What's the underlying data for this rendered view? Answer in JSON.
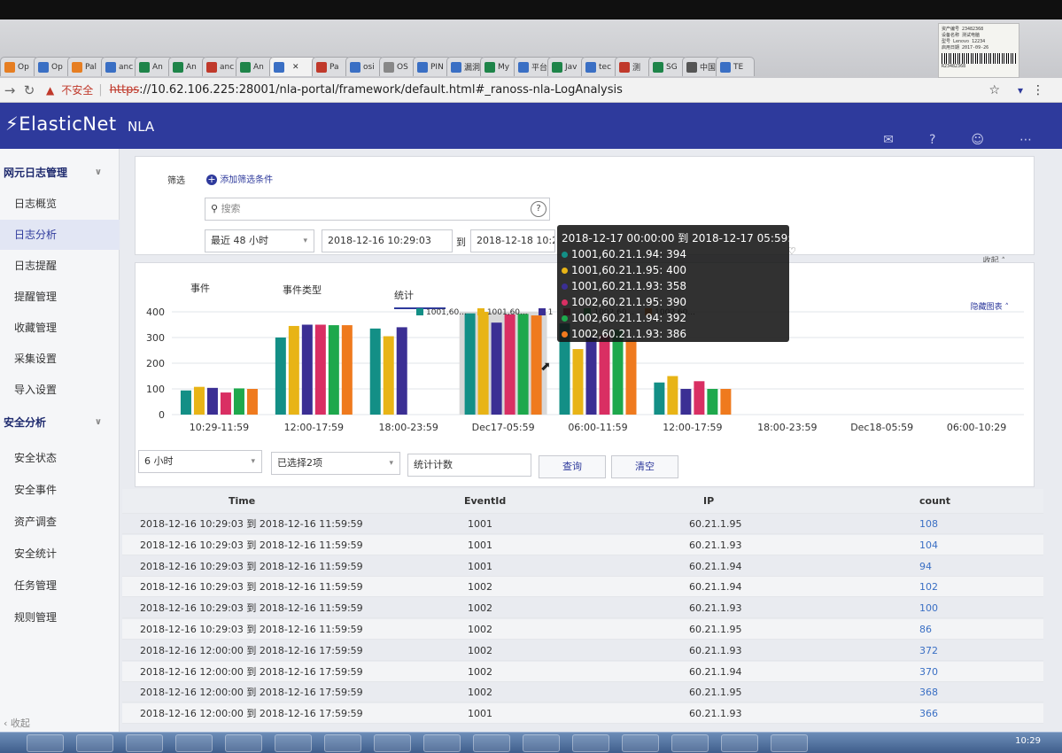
{
  "browser": {
    "tabs": [
      "Op",
      "Op",
      "Pal",
      "anc",
      "An",
      "An",
      "anc",
      "An",
      "",
      "Pa",
      "osi",
      "OS",
      "PIN",
      "漏洞",
      "My",
      "平台",
      "Jav",
      "tec",
      "测",
      "SG",
      "中国",
      "TE"
    ],
    "security_warning": "不安全",
    "url_scheme": "https",
    "url_rest": "://10.62.106.225:28001/nla-portal/framework/default.html#_ranoss-nla-LogAnalysis"
  },
  "sticker": {
    "lines": [
      "资产编号 23482368",
      "设备名称 测试电脑",
      "型号 Lenovo 12234",
      "启用日期 2017-09-26"
    ],
    "id": "R23482368"
  },
  "header": {
    "logo": "ElasticNet",
    "product": "NLA"
  },
  "sidebar": {
    "items": [
      {
        "label": "网元日志管理",
        "type": "group"
      },
      {
        "label": "日志概览",
        "type": "item"
      },
      {
        "label": "日志分析",
        "type": "active"
      },
      {
        "label": "日志提醒",
        "type": "item"
      },
      {
        "label": "提醒管理",
        "type": "item"
      },
      {
        "label": "收藏管理",
        "type": "item"
      },
      {
        "label": "采集设置",
        "type": "item"
      },
      {
        "label": "导入设置",
        "type": "item"
      },
      {
        "label": "安全分析",
        "type": "group"
      },
      {
        "label": "安全状态",
        "type": "item"
      },
      {
        "label": "安全事件",
        "type": "item"
      },
      {
        "label": "资产调查",
        "type": "item"
      },
      {
        "label": "安全统计",
        "type": "item"
      },
      {
        "label": "任务管理",
        "type": "item"
      },
      {
        "label": "规则管理",
        "type": "item"
      }
    ],
    "collapse_label": "收起"
  },
  "filter": {
    "label": "筛选",
    "add_condition": "添加筛选条件",
    "search_placeholder": "搜索",
    "range_select": "最近 48 小时",
    "start_time": "2018-12-16 10:29:03",
    "to": "到",
    "end_time": "2018-12-18 10:29:03",
    "collapse": "收起"
  },
  "analysis": {
    "tabs": [
      "事件",
      "事件类型",
      "统计"
    ],
    "hide_chart": "隐藏图表",
    "interval_select": "6 小时",
    "selected_count": "已选择2项",
    "stat_field": "统计计数",
    "query_button": "查询",
    "clear_button": "清空"
  },
  "chart_data": {
    "type": "bar",
    "categories": [
      "10:29-11:59",
      "12:00-17:59",
      "18:00-23:59",
      "Dec17-05:59",
      "06:00-11:59",
      "12:00-17:59",
      "18:00-23:59",
      "Dec18-05:59",
      "06:00-10:29"
    ],
    "yticks": [
      0,
      100,
      200,
      300,
      400
    ],
    "ylim": [
      0,
      400
    ],
    "series": [
      {
        "name": "1001,60.21.1.94",
        "legend": "1001,60...",
        "color": "#138f86",
        "values": [
          94,
          300,
          335,
          394,
          355,
          125,
          null,
          null,
          null
        ]
      },
      {
        "name": "1001,60.21.1.95",
        "legend": "1001,60...",
        "color": "#e8b416",
        "values": [
          108,
          345,
          305,
          400,
          255,
          150,
          null,
          null,
          null
        ]
      },
      {
        "name": "1001,60.21.1.93",
        "legend": "1",
        "color": "#3b2f94",
        "values": [
          104,
          350,
          340,
          358,
          300,
          100,
          null,
          null,
          null
        ]
      },
      {
        "name": "1002,60.21.1.95",
        "legend": "",
        "color": "#d92f63",
        "values": [
          86,
          350,
          null,
          390,
          310,
          130,
          null,
          null,
          null
        ]
      },
      {
        "name": "1002,60.21.1.94",
        "legend": "1002,60...",
        "color": "#1ea84c",
        "values": [
          102,
          348,
          null,
          392,
          330,
          100,
          null,
          null,
          null
        ]
      },
      {
        "name": "1002,60.21.1.93",
        "legend": "1002,60...",
        "color": "#ef7a1e",
        "values": [
          100,
          348,
          null,
          386,
          290,
          100,
          null,
          null,
          null
        ]
      }
    ]
  },
  "tooltip": {
    "title": "2018-12-17 00:00:00 到 2018-12-17 05:59:59",
    "rows": [
      {
        "text": "1001,60.21.1.94: 394",
        "color": "#138f86"
      },
      {
        "text": "1001,60.21.1.95: 400",
        "color": "#e8b416"
      },
      {
        "text": "1001,60.21.1.93: 358",
        "color": "#3b2f94"
      },
      {
        "text": "1002,60.21.1.95: 390",
        "color": "#d92f63"
      },
      {
        "text": "1002,60.21.1.94: 392",
        "color": "#1ea84c"
      },
      {
        "text": "1002,60.21.1.93: 386",
        "color": "#ef7a1e"
      }
    ]
  },
  "table": {
    "headers": [
      "Time",
      "EventId",
      "IP",
      "count"
    ],
    "rows": [
      [
        "2018-12-16 10:29:03 到 2018-12-16 11:59:59",
        "1001",
        "60.21.1.95",
        "108"
      ],
      [
        "2018-12-16 10:29:03 到 2018-12-16 11:59:59",
        "1001",
        "60.21.1.93",
        "104"
      ],
      [
        "2018-12-16 10:29:03 到 2018-12-16 11:59:59",
        "1001",
        "60.21.1.94",
        "94"
      ],
      [
        "2018-12-16 10:29:03 到 2018-12-16 11:59:59",
        "1002",
        "60.21.1.94",
        "102"
      ],
      [
        "2018-12-16 10:29:03 到 2018-12-16 11:59:59",
        "1002",
        "60.21.1.93",
        "100"
      ],
      [
        "2018-12-16 10:29:03 到 2018-12-16 11:59:59",
        "1002",
        "60.21.1.95",
        "86"
      ],
      [
        "2018-12-16 12:00:00 到 2018-12-16 17:59:59",
        "1002",
        "60.21.1.93",
        "372"
      ],
      [
        "2018-12-16 12:00:00 到 2018-12-16 17:59:59",
        "1002",
        "60.21.1.94",
        "370"
      ],
      [
        "2018-12-16 12:00:00 到 2018-12-16 17:59:59",
        "1002",
        "60.21.1.95",
        "368"
      ],
      [
        "2018-12-16 12:00:00 到 2018-12-16 17:59:59",
        "1001",
        "60.21.1.93",
        "366"
      ]
    ]
  },
  "taskbar": {
    "clock": "10:29"
  }
}
